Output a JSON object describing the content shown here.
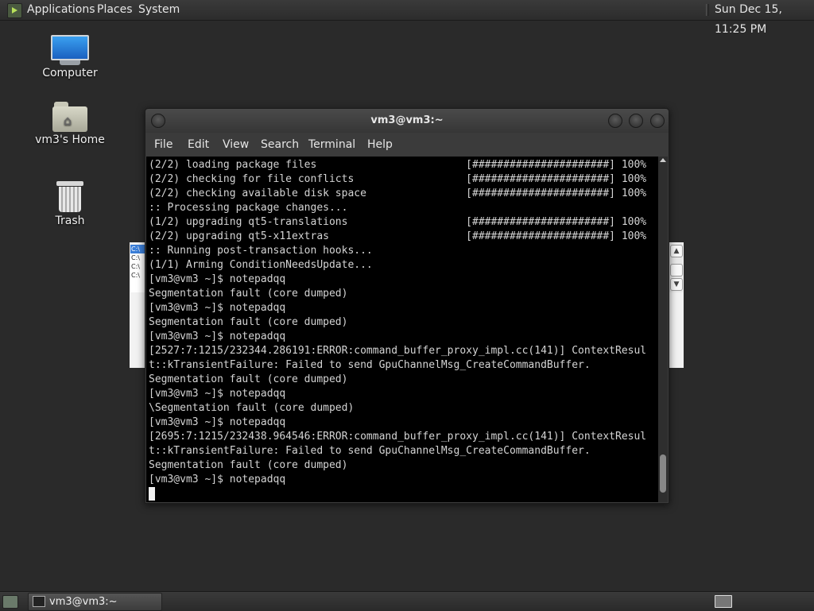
{
  "top_panel": {
    "applications": "Applications",
    "places": "Places",
    "system": "System",
    "clock": "Sun Dec 15, 11:25 PM"
  },
  "desktop": {
    "icons": [
      {
        "label": "Computer",
        "icon": "computer-icon"
      },
      {
        "label": "vm3's Home",
        "icon": "home-folder-icon"
      },
      {
        "label": "Trash",
        "icon": "trash-icon"
      }
    ]
  },
  "background_window": {
    "list_items": [
      "C:\\",
      "C:\\",
      "C:\\",
      "C:\\"
    ]
  },
  "terminal": {
    "title": "vm3@vm3:~",
    "menu": [
      "File",
      "Edit",
      "View",
      "Search",
      "Terminal",
      "Help"
    ],
    "output": "(2/2) loading package files                        [######################] 100%\n(2/2) checking for file conflicts                  [######################] 100%\n(2/2) checking available disk space                [######################] 100%\n:: Processing package changes...\n(1/2) upgrading qt5-translations                   [######################] 100%\n(2/2) upgrading qt5-x11extras                      [######################] 100%\n:: Running post-transaction hooks...\n(1/1) Arming ConditionNeedsUpdate...\n[vm3@vm3 ~]$ notepadqq\nSegmentation fault (core dumped)\n[vm3@vm3 ~]$ notepadqq\nSegmentation fault (core dumped)\n[vm3@vm3 ~]$ notepadqq\n[2527:7:1215/232344.286191:ERROR:command_buffer_proxy_impl.cc(141)] ContextResul\nt::kTransientFailure: Failed to send GpuChannelMsg_CreateCommandBuffer.\nSegmentation fault (core dumped)\n[vm3@vm3 ~]$ notepadqq\n\\Segmentation fault (core dumped)\n[vm3@vm3 ~]$ notepadqq\n[2695:7:1215/232438.964546:ERROR:command_buffer_proxy_impl.cc(141)] ContextResul\nt::kTransientFailure: Failed to send GpuChannelMsg_CreateCommandBuffer.\nSegmentation fault (core dumped)\n[vm3@vm3 ~]$ notepadqq"
  },
  "bottom_panel": {
    "task_label": "vm3@vm3:~"
  }
}
